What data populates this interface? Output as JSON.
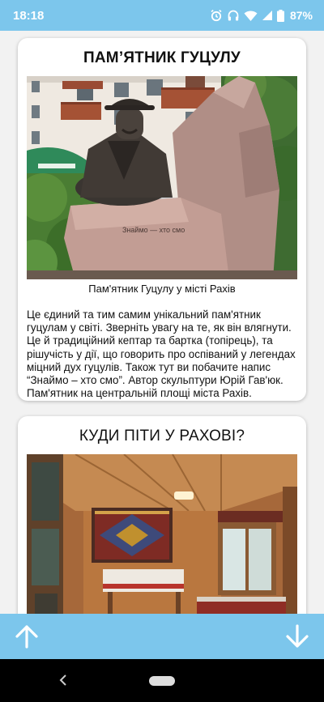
{
  "status_bar": {
    "time": "18:18",
    "battery_percent": "87%",
    "icons": [
      "alarm-icon",
      "headphones-icon",
      "wifi-icon",
      "signal-icon",
      "battery-icon"
    ]
  },
  "cards": [
    {
      "title": "ПАМ’ЯТНИК ГУЦУЛУ",
      "image_caption": "Пам'ятник Гуцулу у місті Рахів",
      "text": "Це єдиний та тим самим унікальний пам'ятник гуцулам у світі. Зверніть увагу на те, як він влягнути. Це й традиційний кептар та бартка (топірець), та рішучість у дії, що говорить про оспіваний у легендах міцний дух гуцулів. Також тут ви побачите напис “Знаймо – хто смо”. Автор скульптури Юрій Гав'юк. Пам'ятник на центральній площі міста Рахів.",
      "inscription": "Знаймо — хто смо"
    },
    {
      "title": "КУДИ ПІТИ У РАХОВІ?"
    }
  ],
  "colors": {
    "accent": "#7cc6ec",
    "card_bg": "#ffffff",
    "page_bg": "#f2f2f2",
    "nav_bg": "#000000"
  },
  "navigation": {
    "up_icon": "arrow-up-icon",
    "down_icon": "arrow-down-icon",
    "back_icon": "back-icon",
    "home_icon": "home-pill-icon"
  }
}
